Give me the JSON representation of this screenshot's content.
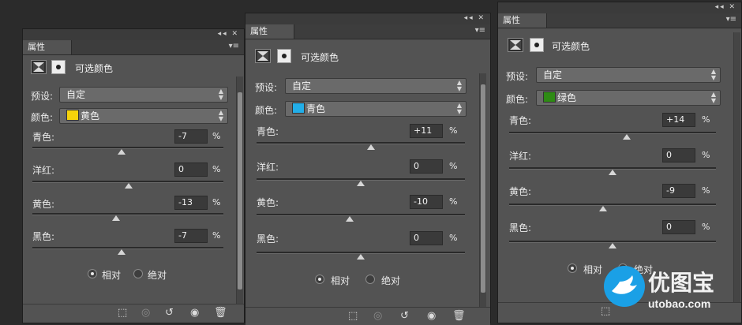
{
  "panels": [
    {
      "tab": "属性",
      "title": "可选颜色",
      "preset_label": "预设:",
      "preset_value": "自定",
      "color_label": "颜色:",
      "color_value": "黄色",
      "color_hex": "#f5d20a",
      "sliders": [
        {
          "label": "青色:",
          "value": "-7",
          "unit": "%",
          "level": -7
        },
        {
          "label": "洋红:",
          "value": "0",
          "unit": "%",
          "level": 0
        },
        {
          "label": "黄色:",
          "value": "-13",
          "unit": "%",
          "level": -13
        },
        {
          "label": "黑色:",
          "value": "-7",
          "unit": "%",
          "level": -7
        }
      ],
      "radio_relative": "相对",
      "radio_absolute": "绝对"
    },
    {
      "tab": "属性",
      "title": "可选颜色",
      "preset_label": "预设:",
      "preset_value": "自定",
      "color_label": "颜色:",
      "color_value": "青色",
      "color_hex": "#22aee8",
      "sliders": [
        {
          "label": "青色:",
          "value": "+11",
          "unit": "%",
          "level": 11
        },
        {
          "label": "洋红:",
          "value": "0",
          "unit": "%",
          "level": 0
        },
        {
          "label": "黄色:",
          "value": "-10",
          "unit": "%",
          "level": -10
        },
        {
          "label": "黑色:",
          "value": "0",
          "unit": "%",
          "level": 0
        }
      ],
      "radio_relative": "相对",
      "radio_absolute": "绝对"
    },
    {
      "tab": "属性",
      "title": "可选颜色",
      "preset_label": "预设:",
      "preset_value": "自定",
      "color_label": "颜色:",
      "color_value": "绿色",
      "color_hex": "#2e8b14",
      "sliders": [
        {
          "label": "青色:",
          "value": "+14",
          "unit": "%",
          "level": 14
        },
        {
          "label": "洋红:",
          "value": "0",
          "unit": "%",
          "level": 0
        },
        {
          "label": "黄色:",
          "value": "-9",
          "unit": "%",
          "level": -9
        },
        {
          "label": "黑色:",
          "value": "0",
          "unit": "%",
          "level": 0
        }
      ],
      "radio_relative": "相对",
      "radio_absolute": "绝对"
    }
  ],
  "top_controls": "◂◂ ✕",
  "menu_glyph": "▾≡",
  "footer_icons": [
    "clip-to-layer-icon",
    "view-previous-state-icon",
    "reset-icon",
    "visibility-eye-icon",
    "trash-icon"
  ],
  "watermark": {
    "text": "优图宝",
    "url": "utobao.com"
  }
}
